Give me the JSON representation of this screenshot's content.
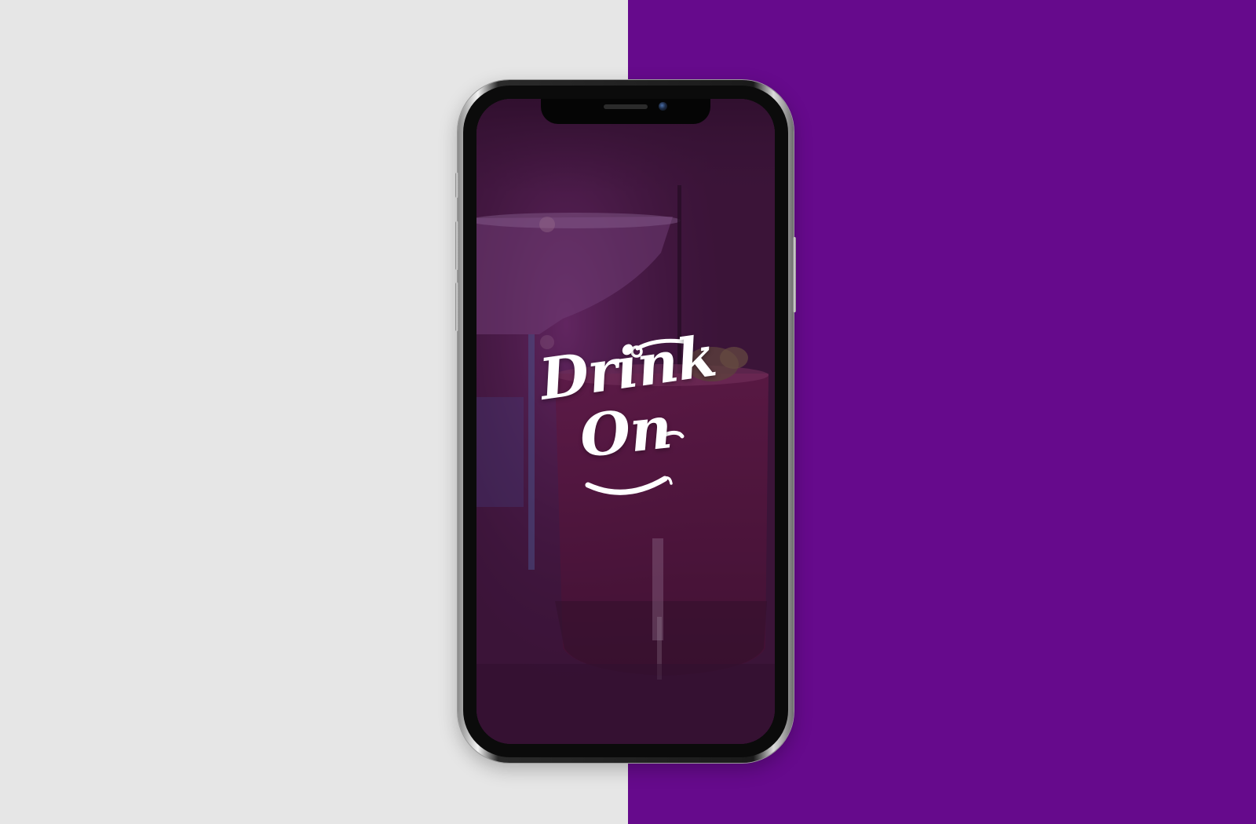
{
  "colors": {
    "background_left": "#e6e6e6",
    "background_right": "#660a8c",
    "screen_tint": "#3a1538",
    "logo": "#ffffff"
  },
  "app_screen": {
    "logo": {
      "line1": "Drink",
      "line2": "On"
    }
  }
}
